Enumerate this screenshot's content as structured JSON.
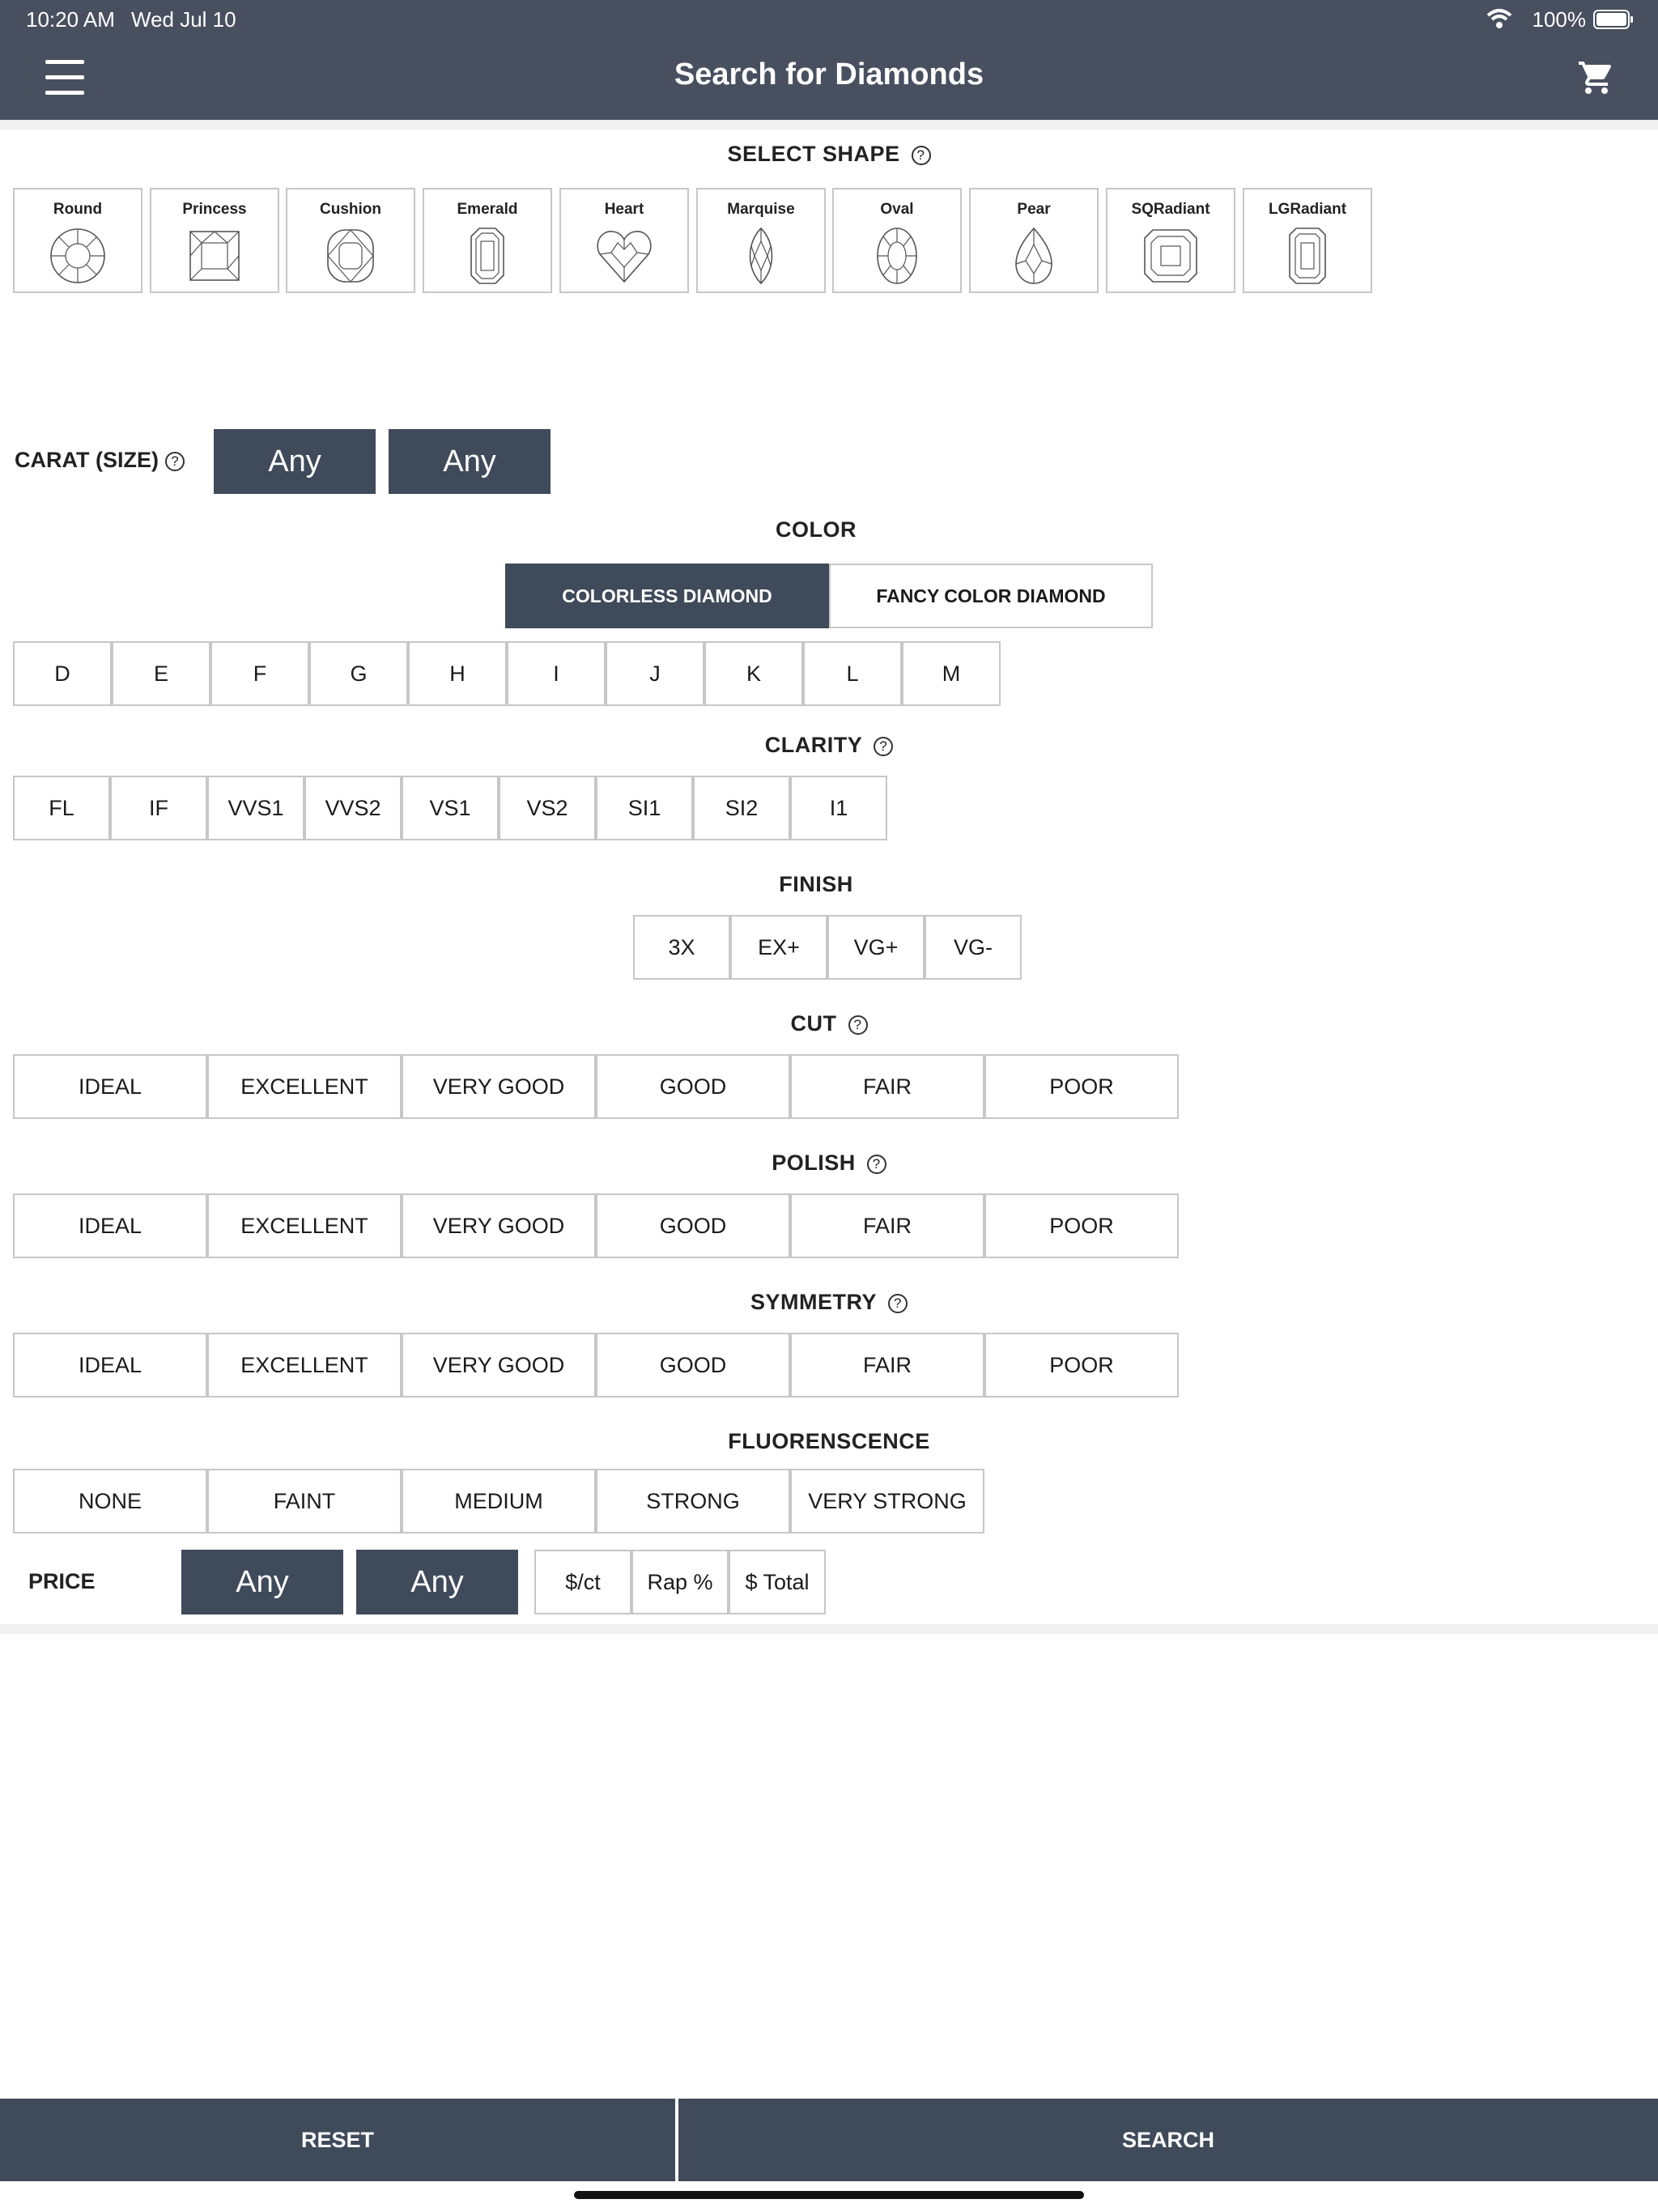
{
  "status": {
    "time": "10:20 AM",
    "date": "Wed Jul 10",
    "battery": "100%"
  },
  "nav": {
    "title": "Search for Diamonds",
    "menu_icon": "hamburger-menu-icon",
    "cart_icon": "cart-icon"
  },
  "shape_section": {
    "heading": "SELECT SHAPE",
    "shapes": [
      "Round",
      "Princess",
      "Cushion",
      "Emerald",
      "Heart",
      "Marquise",
      "Oval",
      "Pear",
      "SQRadiant",
      "LGRadiant"
    ]
  },
  "carat": {
    "label": "CARAT (SIZE)",
    "from": "Any",
    "to": "Any"
  },
  "color": {
    "heading": "COLOR",
    "tabs": [
      "COLORLESS DIAMOND",
      "FANCY COLOR DIAMOND"
    ],
    "active_tab": "COLORLESS DIAMOND",
    "grades": [
      "D",
      "E",
      "F",
      "G",
      "H",
      "I",
      "J",
      "K",
      "L",
      "M"
    ]
  },
  "clarity": {
    "heading": "CLARITY",
    "options": [
      "FL",
      "IF",
      "VVS1",
      "VVS2",
      "VS1",
      "VS2",
      "SI1",
      "SI2",
      "I1"
    ]
  },
  "finish": {
    "heading": "FINISH",
    "options": [
      "3X",
      "EX+",
      "VG+",
      "VG-"
    ]
  },
  "cut": {
    "heading": "CUT",
    "options": [
      "IDEAL",
      "EXCELLENT",
      "VERY GOOD",
      "GOOD",
      "FAIR",
      "POOR"
    ]
  },
  "polish": {
    "heading": "POLISH",
    "options": [
      "IDEAL",
      "EXCELLENT",
      "VERY GOOD",
      "GOOD",
      "FAIR",
      "POOR"
    ]
  },
  "symmetry": {
    "heading": "SYMMETRY",
    "options": [
      "IDEAL",
      "EXCELLENT",
      "VERY GOOD",
      "GOOD",
      "FAIR",
      "POOR"
    ]
  },
  "fluorescence": {
    "heading": "FLUORENSCENCE",
    "options": [
      "NONE",
      "FAINT",
      "MEDIUM",
      "STRONG",
      "VERY STRONG"
    ]
  },
  "price": {
    "label": "PRICE",
    "from": "Any",
    "to": "Any",
    "units": [
      "$/ct",
      "Rap %",
      "$ Total"
    ]
  },
  "actions": {
    "reset": "RESET",
    "search": "SEARCH"
  },
  "colors": {
    "bar": "#485060",
    "selected": "#3f4a5a",
    "border": "#c7c7c7"
  }
}
